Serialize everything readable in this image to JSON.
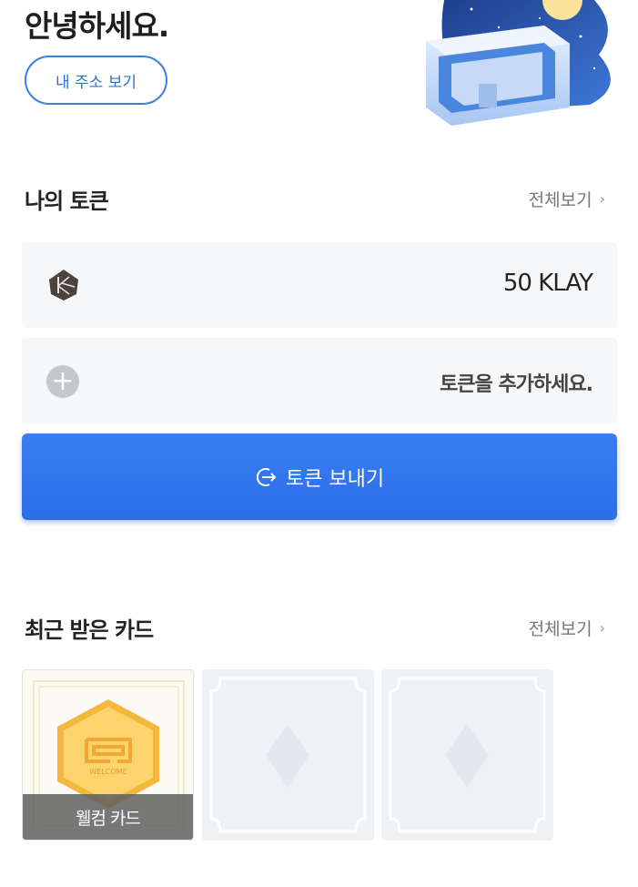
{
  "header": {
    "greeting": "안녕하세요.",
    "view_address_label": "내 주소 보기"
  },
  "my_tokens": {
    "title": "나의 토큰",
    "see_all_label": "전체보기",
    "tokens": [
      {
        "icon": "klay-logo-icon",
        "amount": "50 KLAY"
      }
    ],
    "add_token_label": "토큰을 추가하세요."
  },
  "send_button": {
    "label": "토큰 보내기",
    "icon": "send-arrow-icon",
    "color": "#3079ee"
  },
  "recent_cards": {
    "title": "최근 받은 카드",
    "see_all_label": "전체보기",
    "cards": [
      {
        "label": "웰컴 카드",
        "badge_text": "WELCOME",
        "placeholder": false
      },
      {
        "label": "",
        "placeholder": true
      },
      {
        "label": "",
        "placeholder": true
      }
    ]
  },
  "colors": {
    "accent": "#3079ee",
    "outline_button": "#3f7ed8",
    "row_background": "#f5f7f9"
  }
}
